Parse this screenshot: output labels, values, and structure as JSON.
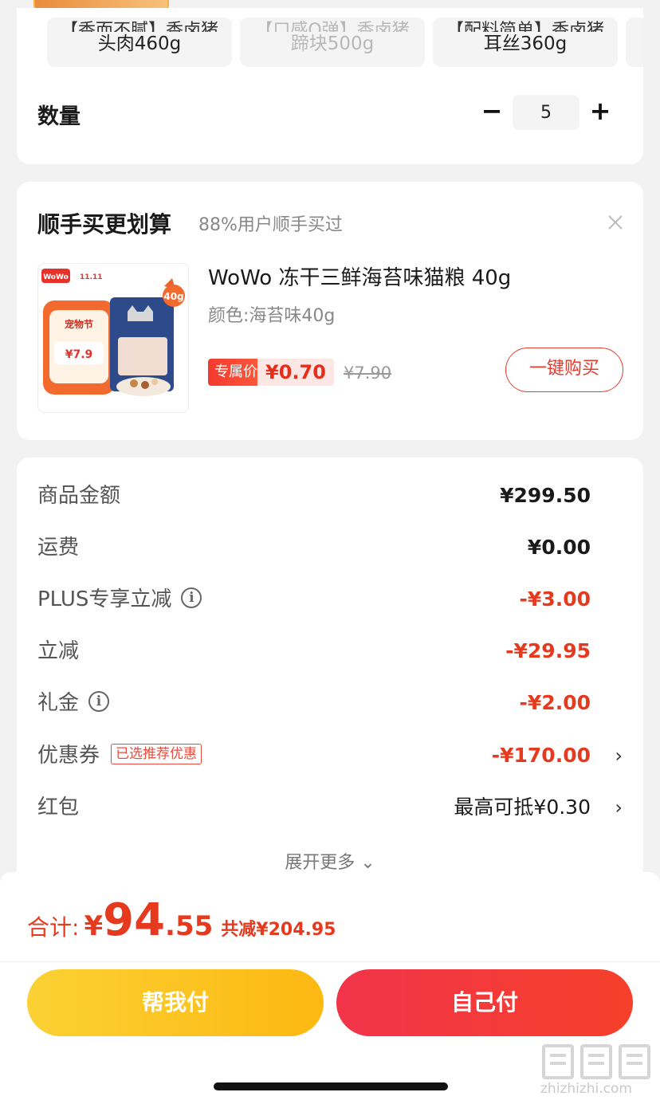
{
  "variants": [
    {
      "top": "【香而不腻】香卤猪",
      "name": "头肉460g",
      "dim": false
    },
    {
      "top": "【口感Q弹】香卤猪",
      "name": "蹄块500g",
      "dim": true
    },
    {
      "top": "【配料简单】香卤猪",
      "name": "耳丝360g",
      "dim": false
    }
  ],
  "quantity": {
    "label": "数量",
    "minus": "−",
    "value": "5",
    "plus": "+"
  },
  "upsell": {
    "title": "顺手买更划算",
    "subtitle": "88%用户顺手买过",
    "product_name": "WoWo 冻干三鲜海苔味猫粮 40g",
    "color_spec": "颜色:海苔味40g",
    "badge": "专属价",
    "price": "¥0.70",
    "original_price": "¥7.90",
    "buy_button": "一键购买",
    "image_badge": "40g",
    "image_price": "¥7.9",
    "image_promo": "宠物节",
    "image_brand": "WoWo",
    "image_event": "11.11"
  },
  "summary": {
    "rows": [
      {
        "label": "商品金额",
        "value": "¥299.50",
        "style": "bold"
      },
      {
        "label": "运费",
        "value": "¥0.00",
        "style": "bold"
      },
      {
        "label": "PLUS专享立减",
        "value": "-¥3.00",
        "style": "red",
        "info": true
      },
      {
        "label": "立减",
        "value": "-¥29.95",
        "style": "red"
      },
      {
        "label": "礼金",
        "value": "-¥2.00",
        "style": "red",
        "info": true
      },
      {
        "label": "优惠券",
        "value": "-¥170.00",
        "style": "red",
        "tag": "已选推荐优惠",
        "chevron": true
      },
      {
        "label": "红包",
        "value": "最高可抵¥0.30",
        "style": "normal",
        "chevron": true
      }
    ],
    "expand": "展开更多 ⌄"
  },
  "footer": {
    "total_label": "合计:",
    "currency": "¥",
    "total_int": "94",
    "total_dec": ".55",
    "saved": "共减¥204.95",
    "help_pay": "帮我付",
    "self_pay": "自己付",
    "watermark": "zhizhizhi.com"
  },
  "colors": {
    "accent_red": "#e63a1e",
    "yellow_button": "#fdb812",
    "red_button": "#f2344a"
  }
}
